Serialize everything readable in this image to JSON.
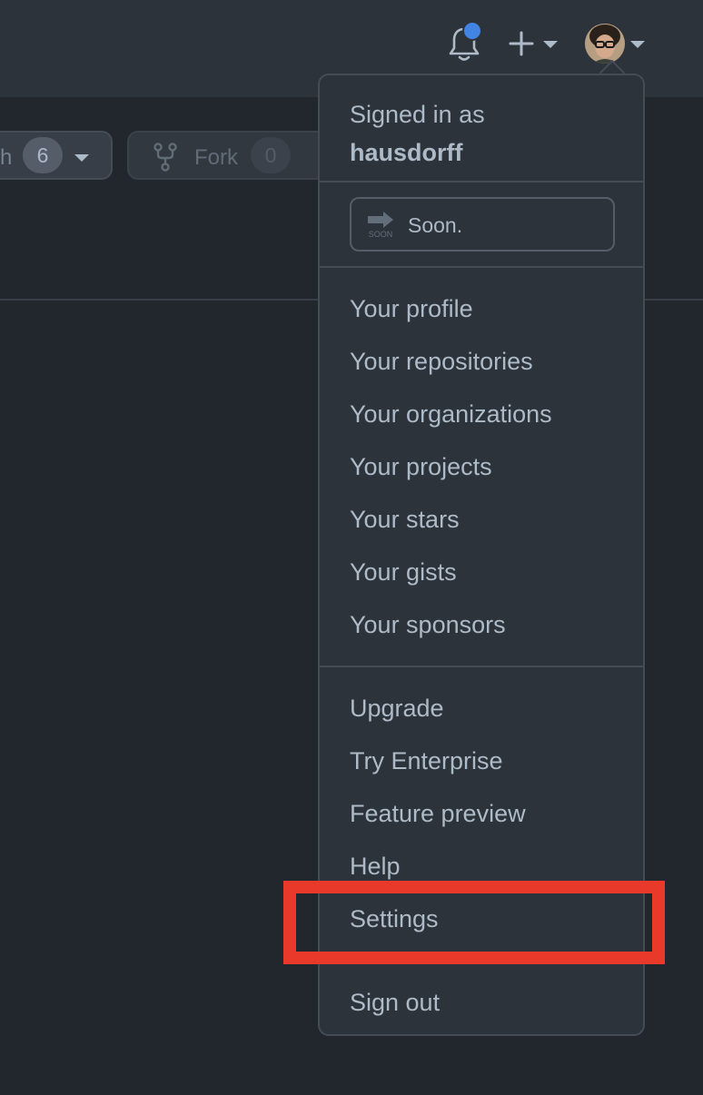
{
  "header": {
    "icons": [
      "bell-icon",
      "plus-icon",
      "avatar"
    ],
    "notification_dot_color": "#4184e4"
  },
  "repo_actions": {
    "watch_label": "h",
    "watch_count": "6",
    "fork_label": "Fork",
    "fork_count": "0"
  },
  "user_menu": {
    "signed_in_prefix": "Signed in as",
    "username": "hausdorff",
    "status_text": "Soon.",
    "status_icon": "soon-arrow-icon",
    "group1": [
      "Your profile",
      "Your repositories",
      "Your organizations",
      "Your projects",
      "Your stars",
      "Your gists",
      "Your sponsors"
    ],
    "group2": [
      "Upgrade",
      "Try Enterprise",
      "Feature preview",
      "Help",
      "Settings"
    ],
    "sign_out": "Sign out"
  },
  "annotation": {
    "highlight_color": "#e8392a",
    "highlighted_item": "Settings"
  }
}
